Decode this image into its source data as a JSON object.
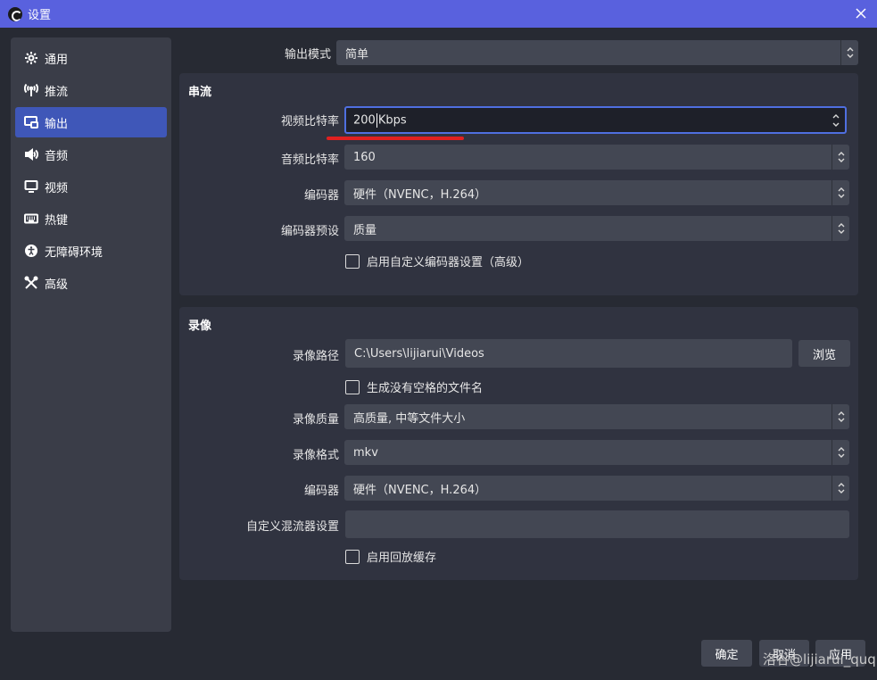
{
  "window": {
    "title": "设置",
    "close_icon": "close-icon"
  },
  "sidebar": {
    "items": [
      {
        "label": "通用",
        "icon": "gear-icon",
        "active": false
      },
      {
        "label": "推流",
        "icon": "antenna-icon",
        "active": false
      },
      {
        "label": "输出",
        "icon": "output-icon",
        "active": true
      },
      {
        "label": "音频",
        "icon": "speaker-icon",
        "active": false
      },
      {
        "label": "视频",
        "icon": "monitor-icon",
        "active": false
      },
      {
        "label": "热键",
        "icon": "keyboard-icon",
        "active": false
      },
      {
        "label": "无障碍环境",
        "icon": "accessibility-icon",
        "active": false
      },
      {
        "label": "高级",
        "icon": "wrench-icon",
        "active": false
      }
    ],
    "active_color": "#3f57b8"
  },
  "output_mode": {
    "label": "输出模式",
    "value": "简单"
  },
  "streaming": {
    "title": "串流",
    "video_bitrate": {
      "label": "视频比特率",
      "value_num": "200",
      "value_unit": "Kbps"
    },
    "audio_bitrate": {
      "label": "音频比特率",
      "value": "160"
    },
    "encoder": {
      "label": "编码器",
      "value": "硬件（NVENC，H.264）"
    },
    "encoder_preset": {
      "label": "编码器预设",
      "value": "质量"
    },
    "custom_encoder": {
      "label": "启用自定义编码器设置（高级）",
      "checked": false
    }
  },
  "recording": {
    "title": "录像",
    "path": {
      "label": "录像路径",
      "value": "C:\\Users\\lijiarui\\Videos",
      "browse_label": "浏览"
    },
    "no_space_filename": {
      "label": "生成没有空格的文件名",
      "checked": false
    },
    "quality": {
      "label": "录像质量",
      "value": "高质量, 中等文件大小"
    },
    "format": {
      "label": "录像格式",
      "value": "mkv"
    },
    "encoder": {
      "label": "编码器",
      "value": "硬件（NVENC，H.264）"
    },
    "muxer": {
      "label": "自定义混流器设置",
      "value": ""
    },
    "replay_buffer": {
      "label": "启用回放缓存",
      "checked": false
    }
  },
  "footer": {
    "ok_label": "确定",
    "cancel_label": "取消",
    "apply_label": "应用"
  },
  "watermark": "洛谷@lijiarui_quq",
  "colors": {
    "titlebar": "#5961de",
    "background": "#272a33",
    "focus_border": "#4f6fe0",
    "annotation_red": "#e02020"
  }
}
